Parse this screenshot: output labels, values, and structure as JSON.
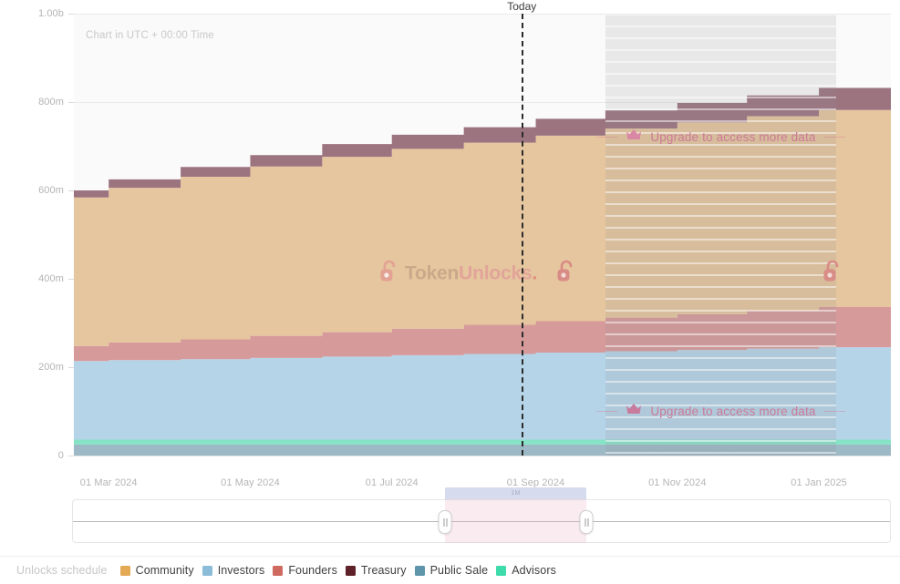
{
  "annotations": {
    "utc_note": "Chart in UTC + 00:00 Time",
    "today_label": "Today",
    "upgrade_text": "Upgrade to access more data",
    "crown_icon": "crown-icon",
    "watermark_token": "Token",
    "watermark_unlocks": "Unlocks",
    "watermark_dot": ".",
    "watermark_icon": "unlock-padlock-icon",
    "slider_tab_label": "1M"
  },
  "legend": {
    "title": "Unlocks schedule",
    "items": [
      {
        "label": "Community",
        "color": "#e0a champion"
      },
      {
        "label": "Investors",
        "color": "#8bbcd8"
      },
      {
        "label": "Founders",
        "color": "#cf6a60"
      },
      {
        "label": "Treasury",
        "color": "#5e2127"
      },
      {
        "label": "Public Sale",
        "color": "#5e95ab"
      },
      {
        "label": "Advisors",
        "color": "#3fdcab"
      }
    ]
  },
  "legend_colors_fixed": {
    "Community": "#e3a955",
    "Investors": "#8bbcd8",
    "Founders": "#cf6a60",
    "Treasury": "#5e2127",
    "Public Sale": "#5e95ab",
    "Advisors": "#3fdcab"
  },
  "chart_data": {
    "type": "area",
    "stacked": true,
    "step": "post",
    "title": "",
    "subtitle": "Chart in UTC + 00:00 Time",
    "xlabel": "",
    "ylabel": "",
    "ylim": [
      0,
      1000000000
    ],
    "yticks": [
      0,
      200000000,
      400000000,
      600000000,
      800000000,
      1000000000
    ],
    "ytick_labels": [
      "0",
      "200m",
      "400m",
      "600m",
      "800m",
      "1.00b"
    ],
    "grid": true,
    "legend_position": "bottom",
    "x_range": [
      "2024-02-15",
      "2025-02-01"
    ],
    "xticks": [
      "2024-03-01",
      "2024-05-01",
      "2024-07-01",
      "2024-09-01",
      "2024-11-01",
      "2025-01-01"
    ],
    "xtick_labels": [
      "01 Mar 2024",
      "01 May 2024",
      "01 Jul 2024",
      "01 Sep 2024",
      "01 Nov 2024",
      "01 Jan 2025"
    ],
    "today": "2024-08-26",
    "locked_from": "2024-10-01",
    "x": [
      "2024-02-15",
      "2024-03-01",
      "2024-04-01",
      "2024-05-01",
      "2024-06-01",
      "2024-07-01",
      "2024-08-01",
      "2024-09-01",
      "2024-10-01",
      "2024-11-01",
      "2024-12-01",
      "2025-01-01",
      "2025-02-01"
    ],
    "series": [
      {
        "name": "Public Sale",
        "color": "#9db9c6",
        "values": [
          25000000,
          25000000,
          25000000,
          25000000,
          25000000,
          25000000,
          25000000,
          25000000,
          25000000,
          25000000,
          25000000,
          25000000,
          25000000
        ]
      },
      {
        "name": "Advisors",
        "color": "#86e3c6",
        "values": [
          11000000,
          11000000,
          11000000,
          11000000,
          11000000,
          11000000,
          11000000,
          11000000,
          11000000,
          11000000,
          11000000,
          11000000,
          11000000
        ]
      },
      {
        "name": "Investors",
        "color": "#b5d4e8",
        "values": [
          178000000,
          180000000,
          182000000,
          185000000,
          188000000,
          191000000,
          194000000,
          197000000,
          200000000,
          203000000,
          206000000,
          209000000,
          209000000
        ]
      },
      {
        "name": "Founders",
        "color": "#d79a9a",
        "values": [
          34000000,
          40000000,
          45000000,
          50000000,
          55000000,
          60000000,
          66000000,
          71000000,
          76000000,
          81000000,
          86000000,
          91000000,
          91000000
        ]
      },
      {
        "name": "Community",
        "color": "#e6c69e",
        "values": [
          336000000,
          350000000,
          368000000,
          383000000,
          397000000,
          407000000,
          412000000,
          420000000,
          428000000,
          434000000,
          440000000,
          446000000,
          446000000
        ]
      },
      {
        "name": "Treasury",
        "color": "#9b7480",
        "values": [
          16000000,
          19000000,
          22000000,
          26000000,
          29000000,
          32000000,
          35000000,
          38000000,
          41000000,
          44000000,
          47000000,
          50000000,
          50000000
        ]
      }
    ],
    "totals": [
      600000000,
      625000000,
      653000000,
      680000000,
      705000000,
      726000000,
      743000000,
      762000000,
      781000000,
      798000000,
      815000000,
      832000000,
      832000000
    ]
  }
}
